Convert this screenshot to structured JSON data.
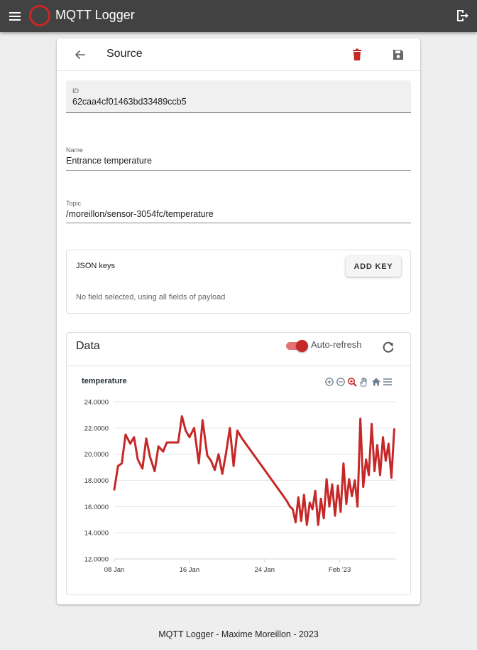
{
  "app": {
    "title": "MQTT Logger",
    "menu_icon": "menu-icon",
    "logo_icon": "logo-ring-icon",
    "logout_icon": "logout-icon"
  },
  "source": {
    "title": "Source",
    "back_icon": "arrow-left-icon",
    "delete_icon": "trash-icon",
    "save_icon": "floppy-disk-icon",
    "delete_color": "#c62828",
    "fields": {
      "id": {
        "label": "ID",
        "value": "62caa4cf01463bd33489ccb5"
      },
      "name": {
        "label": "Name",
        "value": "Entrance temperature"
      },
      "topic": {
        "label": "Topic",
        "value": "/moreillon/sensor-3054fc/temperature"
      }
    },
    "json_keys": {
      "title": "JSON keys",
      "add_label": "ADD KEY",
      "hint": "No field selected, using all fields of payload"
    },
    "data": {
      "title": "Data",
      "auto_refresh_label": "Auto-refresh",
      "auto_refresh_on": true,
      "refresh_icon": "refresh-icon",
      "accent": "#c62828"
    }
  },
  "chart_data": {
    "type": "line",
    "title": "temperature",
    "x_tick_labels": [
      "08 Jan",
      "16 Jan",
      "24 Jan",
      "Feb '23"
    ],
    "x_tick_days": [
      8,
      16,
      24,
      32
    ],
    "y_tick_labels": [
      "24.0000",
      "22.0000",
      "20.0000",
      "18.0000",
      "16.0000",
      "14.0000",
      "12.0000"
    ],
    "ylim": [
      12,
      24
    ],
    "xlim_days": [
      8,
      38
    ],
    "grid": true,
    "series": [
      {
        "color": "#c62828",
        "x_days": [
          8.0,
          8.4,
          8.8,
          9.2,
          9.7,
          10.1,
          10.5,
          11.0,
          11.4,
          11.8,
          12.3,
          12.7,
          13.2,
          13.6,
          14.0,
          14.4,
          14.8,
          15.2,
          15.6,
          16.0,
          16.5,
          17.0,
          17.4,
          17.9,
          18.3,
          18.7,
          19.1,
          19.5,
          19.9,
          20.3,
          20.7,
          21.1,
          21.6,
          26.3,
          26.7,
          27.0,
          27.3,
          27.6,
          27.9,
          28.2,
          28.5,
          28.8,
          29.1,
          29.4,
          29.7,
          30.0,
          30.3,
          30.6,
          30.9,
          31.2,
          31.5,
          31.8,
          32.1,
          32.4,
          32.7,
          33.0,
          33.3,
          33.6,
          33.9,
          34.2,
          34.5,
          34.8,
          35.1,
          35.4,
          35.7,
          36.0,
          36.3,
          36.6,
          36.9,
          37.2,
          37.5,
          37.8
        ],
        "y": [
          17.3,
          19.1,
          19.3,
          21.5,
          20.8,
          21.3,
          19.6,
          18.9,
          21.2,
          19.8,
          18.7,
          20.6,
          20.2,
          20.9,
          20.9,
          20.9,
          20.9,
          22.9,
          21.8,
          21.3,
          22.0,
          19.3,
          22.6,
          19.9,
          19.5,
          18.8,
          20.0,
          18.5,
          20.1,
          22.0,
          19.1,
          21.8,
          21.2,
          16.5,
          16.0,
          15.8,
          14.8,
          16.7,
          14.9,
          16.9,
          14.6,
          16.3,
          15.8,
          17.2,
          14.6,
          16.6,
          15.1,
          18.1,
          16.0,
          17.7,
          15.3,
          17.6,
          15.6,
          19.3,
          16.2,
          18.1,
          16.8,
          18.0,
          16.0,
          22.7,
          17.5,
          19.6,
          18.4,
          22.3,
          18.7,
          20.7,
          18.4,
          21.3,
          19.5,
          20.8,
          18.2,
          21.9
        ]
      }
    ]
  },
  "footer": {
    "text": "MQTT Logger - Maxime Moreillon - 2023"
  }
}
